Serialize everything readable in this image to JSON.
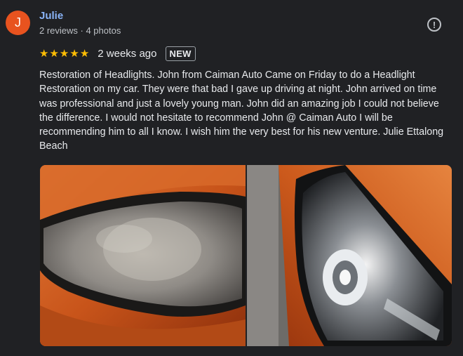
{
  "review": {
    "author_initial": "J",
    "author_name": "Julie",
    "author_meta": "2 reviews · 4 photos",
    "rating": 5,
    "star_glyph": "★",
    "time": "2 weeks ago",
    "badge": "NEW",
    "report_icon": "!",
    "text": "Restoration of Headlights. John from Caiman Auto Came on Friday to do a Headlight Restoration on my car. They were that bad I gave up driving at night. John arrived on time was professional and just a lovely young man. John did an amazing job I could not believe the difference. I would not hesitate to recommend John @ Caiman Auto I will be recommending him to all I know. I wish him the very best for his new venture. Julie Ettalong Beach"
  },
  "colors": {
    "background": "#202124",
    "avatar": "#e8531f",
    "name": "#8ab4f8",
    "star": "#fbbc04"
  }
}
